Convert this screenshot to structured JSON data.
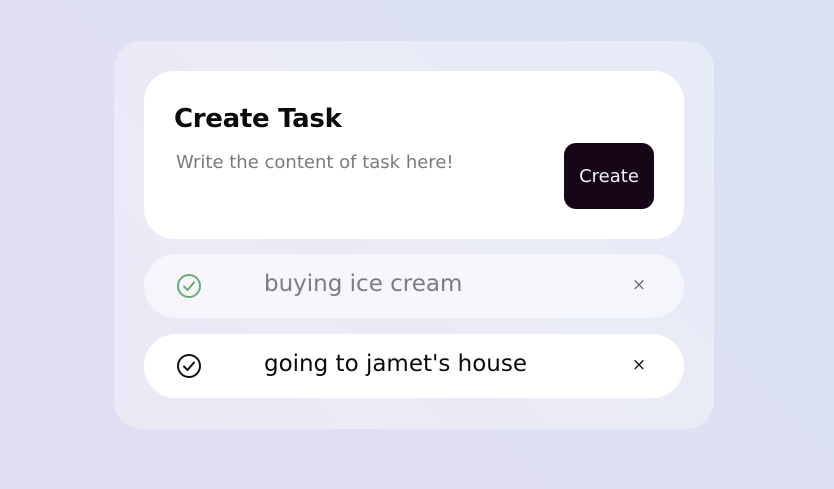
{
  "create_card": {
    "title": "Create Task",
    "input_placeholder": "Write the content of task here!",
    "input_value": "",
    "create_label": "Create"
  },
  "tasks": [
    {
      "text": "buying ice cream",
      "completed": true,
      "check_color": "#6aaa75",
      "delete_glyph": "×"
    },
    {
      "text": "going to jamet's house",
      "completed": false,
      "check_color": "#111111",
      "delete_glyph": "×"
    }
  ],
  "colors": {
    "create_button_bg": "#160617",
    "done_check": "#6aaa75"
  }
}
